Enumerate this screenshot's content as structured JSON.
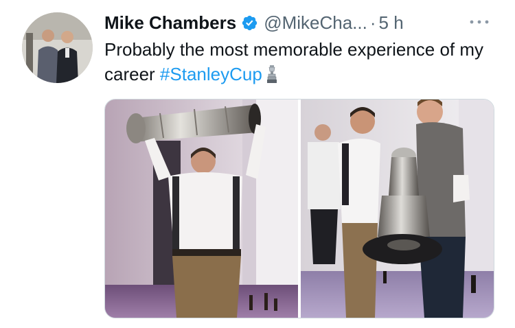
{
  "tweet": {
    "author_name": "Mike Chambers",
    "handle": "@MikeCha...",
    "separator": "·",
    "time": "5 h",
    "text_part1": "Probably the most memorable experience of my career ",
    "hashtag": "#StanleyCup",
    "more_icon": "more-horizontal-icon",
    "verified_icon": "verified-badge-icon",
    "emoji_icon": "trophy-cup-icon"
  },
  "colors": {
    "link": "#1d9bf0",
    "secondary_text": "#536471",
    "verified": "#1d9bf0"
  }
}
